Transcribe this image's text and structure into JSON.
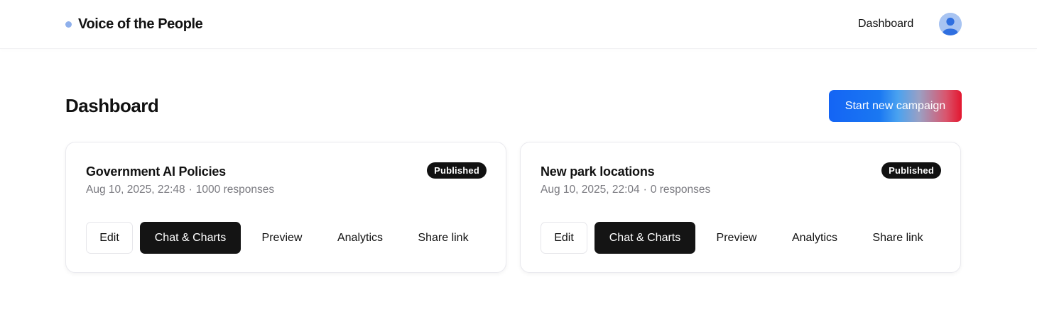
{
  "header": {
    "brand": "Voice of the People",
    "nav_dashboard": "Dashboard",
    "avatar_icon": "user-avatar-icon"
  },
  "main": {
    "title": "Dashboard",
    "cta_label": "Start new campaign"
  },
  "campaigns": [
    {
      "title": "Government AI Policies",
      "date": "Aug 10, 2025, 22:48",
      "separator": "·",
      "responses": "1000 responses",
      "status": "Published",
      "actions": {
        "edit": "Edit",
        "chat": "Chat & Charts",
        "preview": "Preview",
        "analytics": "Analytics",
        "share": "Share link"
      }
    },
    {
      "title": "New park locations",
      "date": "Aug 10, 2025, 22:04",
      "separator": "·",
      "responses": "0 responses",
      "status": "Published",
      "actions": {
        "edit": "Edit",
        "chat": "Chat & Charts",
        "preview": "Preview",
        "analytics": "Analytics",
        "share": "Share link"
      }
    }
  ],
  "colors": {
    "primary_dark": "#141414",
    "brand_dot": "#8fb0ec",
    "cta_gradient_start": "#1464f4",
    "cta_gradient_end": "#e3162f",
    "meta_text": "#7a7a80"
  }
}
